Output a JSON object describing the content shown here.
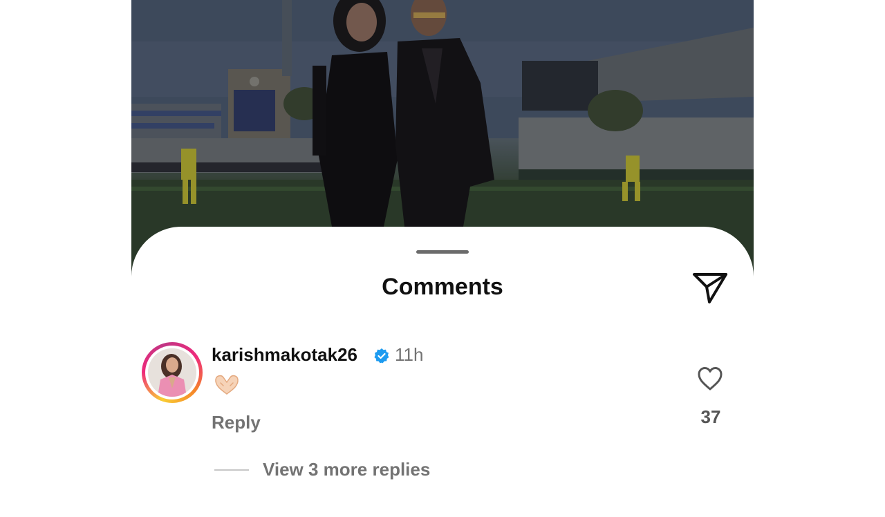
{
  "post": {
    "image_alt": "post-photo"
  },
  "comments_sheet": {
    "title": "Comments",
    "share_icon": "send-icon"
  },
  "comment": {
    "username": "karishmakotak26",
    "verified_icon": "verified-badge-icon",
    "time": "11h",
    "body_emoji": "heart-hands-emoji",
    "reply_label": "Reply",
    "like_icon": "heart-outline-icon",
    "like_count": "37",
    "view_more_replies": "View 3 more replies"
  },
  "colors": {
    "text_primary": "#111111",
    "text_secondary": "#737373",
    "verified_blue": "#1d9bf0",
    "handle": "#6b6b6b"
  }
}
